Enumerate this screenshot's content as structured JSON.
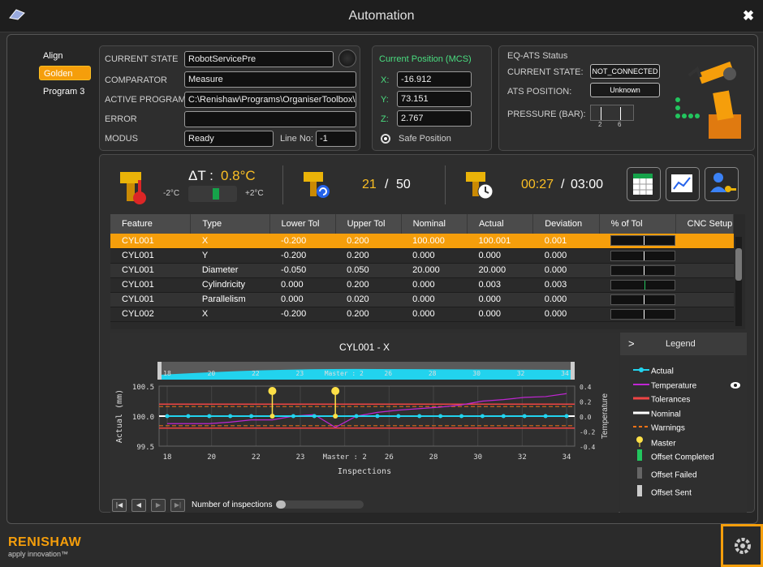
{
  "window": {
    "title": "Automation",
    "close_glyph": "✖"
  },
  "programs": [
    "Align",
    "Golden",
    "Program 3"
  ],
  "selected_program": "Golden",
  "state": {
    "current_state_label": "CURRENT STATE",
    "current_state_value": "RobotServicePre",
    "comparator_label": "COMPARATOR",
    "comparator_value": "Measure",
    "active_program_label": "ACTIVE PROGRAM",
    "active_program_value": "C:\\Renishaw\\Programs\\OrganiserToolbox\\Or-",
    "error_label": "ERROR",
    "error_value": "",
    "modus_label": "MODUS",
    "modus_value": "Ready",
    "line_no_label": "Line No:",
    "line_no_value": "-1"
  },
  "position": {
    "title": "Current Position (MCS)",
    "x_label": "X:",
    "x_value": "-16.912",
    "y_label": "Y:",
    "y_value": "73.151",
    "z_label": "Z:",
    "z_value": "2.767",
    "safe_label": "Safe Position"
  },
  "eqats": {
    "title": "EQ-ATS Status",
    "state_label": "CURRENT STATE:",
    "state_value": "NOT_CONNECTED",
    "ats_label": "ATS POSITION:",
    "ats_value": "Unknown",
    "pressure_label": "PRESSURE (BAR):",
    "pressure_tick_low": "2",
    "pressure_tick_high": "6"
  },
  "stats": {
    "delta_t_label": "ΔT :",
    "delta_t_value": "0.8°C",
    "temp_min": "-2°C",
    "temp_max": "+2°C",
    "count_current": "21",
    "count_sep": "/",
    "count_total": "50",
    "time_current": "00:27",
    "time_sep": "/",
    "time_total": "03:00"
  },
  "table": {
    "headers": [
      "Feature",
      "Type",
      "Lower Tol",
      "Upper Tol",
      "Nominal",
      "Actual",
      "Deviation",
      "% of Tol",
      "CNC Setup"
    ],
    "rows": [
      [
        "CYL001",
        "X",
        "-0.200",
        "0.200",
        "100.000",
        "100.001",
        "0.001"
      ],
      [
        "CYL001",
        "Y",
        "-0.200",
        "0.200",
        "0.000",
        "0.000",
        "0.000"
      ],
      [
        "CYL001",
        "Diameter",
        "-0.050",
        "0.050",
        "20.000",
        "20.000",
        "0.000"
      ],
      [
        "CYL001",
        "Cylindricity",
        "0.000",
        "0.200",
        "0.000",
        "0.003",
        "0.003"
      ],
      [
        "CYL001",
        "Parallelism",
        "0.000",
        "0.020",
        "0.000",
        "0.000",
        "0.000"
      ],
      [
        "CYL002",
        "X",
        "-0.200",
        "0.200",
        "0.000",
        "0.000",
        "0.000"
      ]
    ],
    "pct_of_tol": [
      0.0,
      0.0,
      0.0,
      1.5,
      0.0,
      0.0
    ]
  },
  "chart_data": {
    "type": "line",
    "title": "CYL001 - X",
    "xlabel": "Inspections",
    "ylabel": "Actual (mm)",
    "y2label": "Temperature",
    "x_tick_labels": [
      "18",
      "20",
      "22",
      "23",
      "Master : 2",
      "26",
      "28",
      "30",
      "32",
      "34"
    ],
    "y_ticks": [
      "100.5",
      "100.0",
      "99.5"
    ],
    "y2_ticks": [
      "0.4",
      "0.2",
      "0.0",
      "-0.2",
      "-0.4"
    ],
    "ylim": [
      99.5,
      100.5
    ],
    "y2lim": [
      -0.4,
      0.4
    ],
    "nominal": 100.0,
    "tolerances": [
      100.2,
      99.8
    ],
    "warnings": [
      100.16,
      99.84
    ],
    "series": [
      {
        "name": "Actual",
        "values": [
          100.0,
          100.0,
          100.0,
          100.0,
          100.0,
          100.0,
          100.0,
          100.0,
          100.0,
          100.0,
          100.0,
          100.0,
          100.0,
          100.0,
          100.0,
          100.0,
          100.0,
          100.0,
          100.0,
          100.0
        ]
      },
      {
        "name": "Temperature",
        "values": [
          -0.1,
          -0.1,
          -0.1,
          -0.08,
          -0.05,
          -0.05,
          0.0,
          0.02,
          -0.15,
          0.0,
          0.05,
          0.08,
          0.1,
          0.12,
          0.15,
          0.2,
          0.22,
          0.25,
          0.26,
          0.3
        ]
      }
    ],
    "master_indices": [
      5,
      8
    ],
    "slider_labels": [
      "18",
      "20",
      "22",
      "23",
      "Master : 2",
      "26",
      "28",
      "30",
      "32",
      "34"
    ]
  },
  "legend": {
    "title": "Legend",
    "items": [
      "Actual",
      "Temperature",
      "Tolerances",
      "Nominal",
      "Warnings",
      "Master",
      "Offset Completed",
      "Offset Failed",
      "Offset Sent"
    ]
  },
  "footer": {
    "num_inspections_label": "Number of inspections",
    "brand": "RENISHAW",
    "tagline": "apply innovation™"
  },
  "colors": {
    "accent": "#f59e0b",
    "actual": "#22d3ee",
    "temperature": "#c026d3",
    "tolerance": "#ef4444",
    "warning": "#f97316",
    "master": "#fde047"
  }
}
